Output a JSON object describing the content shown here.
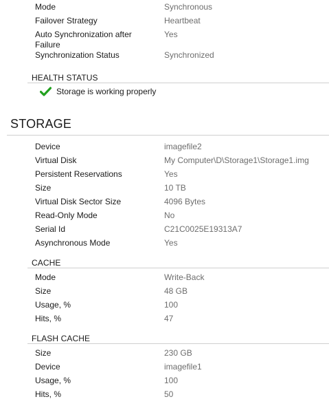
{
  "replication": {
    "rows": [
      {
        "label": "Mode",
        "value": "Synchronous"
      },
      {
        "label": "Failover Strategy",
        "value": "Heartbeat"
      },
      {
        "label_line1": "Auto Synchronization after",
        "label_line2": "Failure",
        "value": "Yes"
      },
      {
        "label": "Synchronization Status",
        "value": "Synchronized"
      }
    ]
  },
  "health": {
    "heading": "HEALTH STATUS",
    "status_text": "Storage is working properly",
    "status_color": "#22a11f"
  },
  "storage": {
    "heading": "STORAGE",
    "rows": [
      {
        "label": "Device",
        "value": "imagefile2"
      },
      {
        "label": "Virtual Disk",
        "value": "My Computer\\D\\Storage1\\Storage1.img"
      },
      {
        "label": "Persistent Reservations",
        "value": "Yes"
      },
      {
        "label": "Size",
        "value": "10 TB"
      },
      {
        "label": "Virtual Disk Sector Size",
        "value": "4096 Bytes"
      },
      {
        "label": "Read-Only Mode",
        "value": "No"
      },
      {
        "label": "Serial Id",
        "value": "C21C0025E19313A7"
      },
      {
        "label": "Asynchronous Mode",
        "value": "Yes"
      }
    ]
  },
  "cache": {
    "heading": "CACHE",
    "rows": [
      {
        "label": "Mode",
        "value": "Write-Back"
      },
      {
        "label": "Size",
        "value": "48 GB"
      },
      {
        "label": "Usage, %",
        "value": "100"
      },
      {
        "label": "Hits, %",
        "value": "47"
      }
    ]
  },
  "flash_cache": {
    "heading": "FLASH CACHE",
    "rows": [
      {
        "label": "Size",
        "value": "230 GB"
      },
      {
        "label": "Device",
        "value": "imagefile1"
      },
      {
        "label": "Usage, %",
        "value": "100"
      },
      {
        "label": "Hits, %",
        "value": "50"
      }
    ]
  }
}
